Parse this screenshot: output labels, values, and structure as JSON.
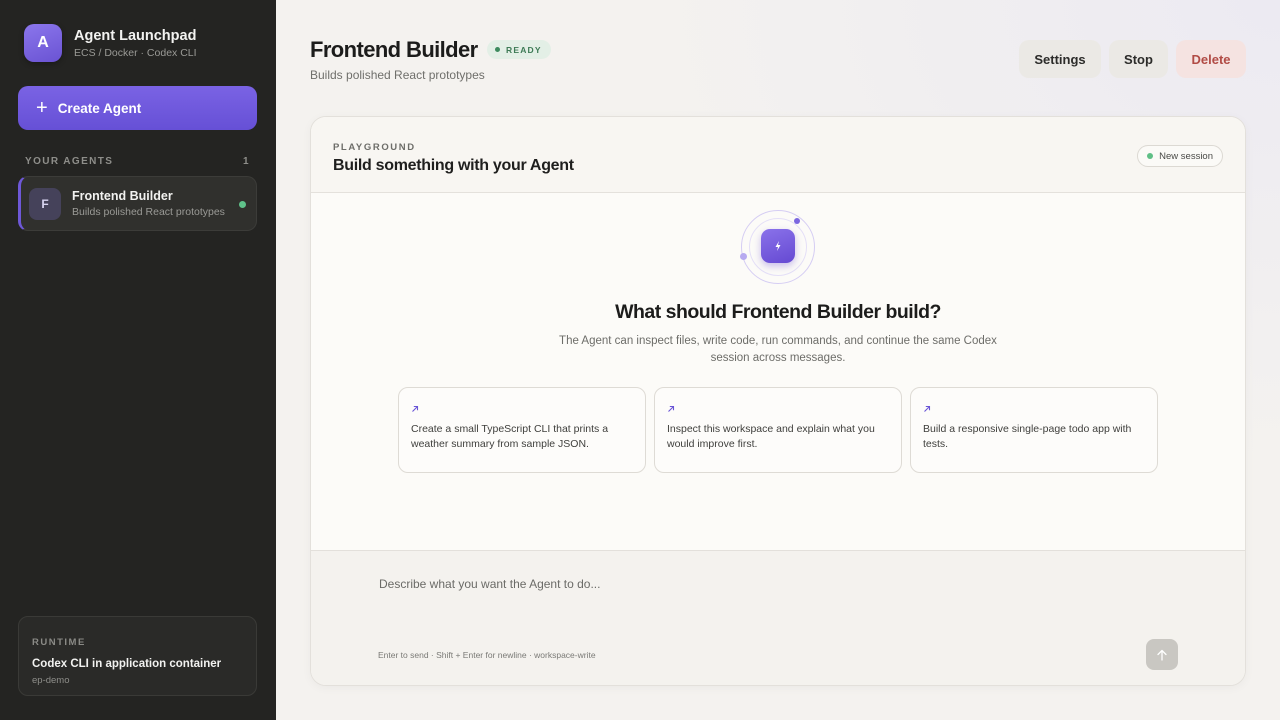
{
  "sidebar": {
    "brand_initial": "A",
    "brand_title": "Agent Launchpad",
    "brand_subtitle": "ECS / Docker · Codex CLI",
    "create_label": "Create Agent",
    "section_title": "YOUR AGENTS",
    "agent_count": "1",
    "agents": [
      {
        "initial": "F",
        "name": "Frontend Builder",
        "description": "Builds polished React prototypes",
        "status_color": "#5fc28a"
      }
    ],
    "runtime": {
      "label": "RUNTIME",
      "title": "Codex CLI in application container",
      "subtitle": "ep-demo"
    }
  },
  "header": {
    "title": "Frontend Builder",
    "status": "READY",
    "subtitle": "Builds polished React prototypes",
    "settings_label": "Settings",
    "stop_label": "Stop",
    "delete_label": "Delete"
  },
  "playground": {
    "label": "PLAYGROUND",
    "title": "Build something with your Agent",
    "session_label": "New session",
    "hero_title": "What should Frontend Builder build?",
    "hero_description": "The Agent can inspect files, write code, run commands, and continue the same Codex session across messages.",
    "suggestions": [
      "Create a small TypeScript CLI that prints a weather summary from sample JSON.",
      "Inspect this workspace and explain what you would improve first.",
      "Build a responsive single-page todo app with tests."
    ]
  },
  "composer": {
    "placeholder": "Describe what you want the Agent to do...",
    "hint": "Enter to send · Shift + Enter for newline · workspace-write"
  },
  "icons": {
    "hero": "lightning-icon",
    "suggestion": "arrow-up-right-icon",
    "send": "arrow-up-icon",
    "create": "plus-icon"
  },
  "colors": {
    "accent": "#6e58d8",
    "sidebar_bg": "#242422",
    "ready": "#3d8a5e",
    "delete": "#b14c46"
  }
}
